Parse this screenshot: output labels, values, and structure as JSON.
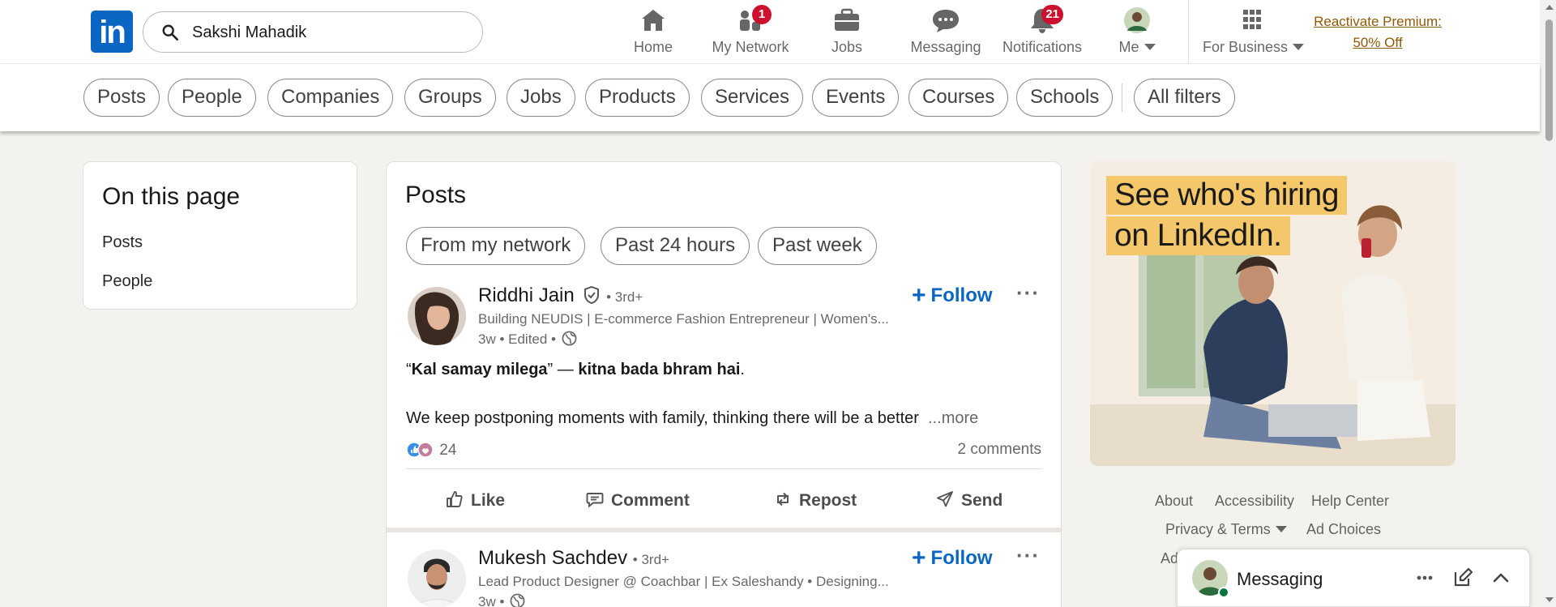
{
  "topnav": {
    "logo_text": "in",
    "search_value": "Sakshi Mahadik",
    "items": [
      {
        "label": "Home",
        "icon": "home-icon"
      },
      {
        "label": "My Network",
        "icon": "network-icon",
        "badge": "1"
      },
      {
        "label": "Jobs",
        "icon": "briefcase-icon"
      },
      {
        "label": "Messaging",
        "icon": "messaging-icon"
      },
      {
        "label": "Notifications",
        "icon": "bell-icon",
        "badge": "21"
      },
      {
        "label": "Me",
        "icon": "avatar"
      },
      {
        "label": "For Business",
        "icon": "grid-icon"
      }
    ],
    "premium_line1": "Reactivate Premium:",
    "premium_line2": "50% Off"
  },
  "filters": [
    "Posts",
    "People",
    "Companies",
    "Groups",
    "Jobs",
    "Products",
    "Services",
    "Events",
    "Courses",
    "Schools",
    "All filters"
  ],
  "toc": {
    "title": "On this page",
    "links": [
      "Posts",
      "People"
    ]
  },
  "posts_section": {
    "title": "Posts",
    "subfilters": [
      "From my network",
      "Past 24 hours",
      "Past week"
    ],
    "posts": [
      {
        "name": "Riddhi Jain",
        "degree": "• 3rd+",
        "headline": "Building NEUDIS | E-commerce Fashion Entrepreneur | Women's...",
        "meta": "3w • Edited •",
        "follow": "Follow",
        "text_q_open": "“",
        "text_bold1": "Kal samay milega",
        "text_q_close": "” — ",
        "text_bold2": "kitna bada bhram hai",
        "text_end": ".",
        "text_line2": "We keep postponing moments with family, thinking there will be a better",
        "see_more": "...more",
        "reactions_count": "24",
        "comments": "2 comments"
      },
      {
        "name": "Mukesh Sachdev",
        "degree": "• 3rd+",
        "headline": "Lead Product Designer @ Coachbar | Ex Saleshandy • Designing...",
        "meta": "3w •",
        "follow": "Follow"
      }
    ],
    "actions": [
      "Like",
      "Comment",
      "Repost",
      "Send"
    ]
  },
  "ad": {
    "line1": "See who's hiring",
    "line2": "on LinkedIn."
  },
  "footer": {
    "links": [
      "About",
      "Accessibility",
      "Help Center",
      "Privacy & Terms",
      "Ad Choices",
      "Ad"
    ]
  },
  "messaging": {
    "title": "Messaging"
  },
  "colors": {
    "brand": "#0a66c2",
    "badge": "#cb112d",
    "premium": "#915907",
    "background": "#f4f2ee"
  }
}
